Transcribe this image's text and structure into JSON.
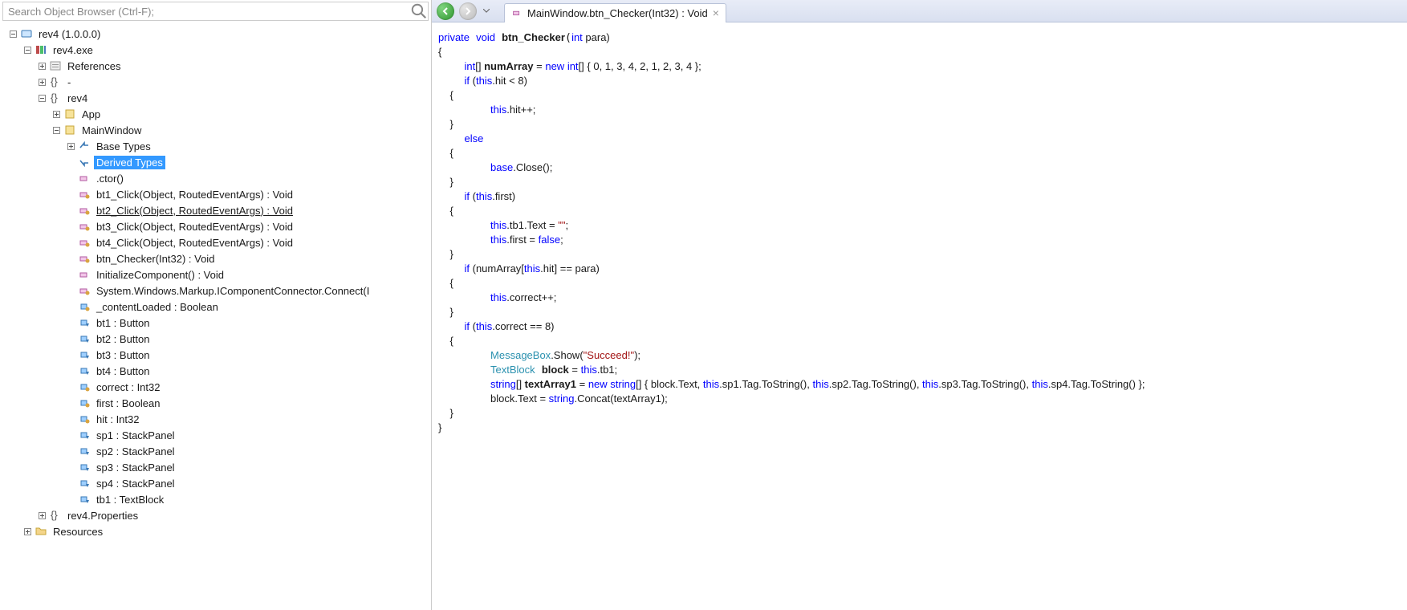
{
  "search": {
    "placeholder": "Search Object Browser (Ctrl-F);"
  },
  "tree": {
    "root": {
      "label": "rev4 (1.0.0.0)"
    },
    "exe": {
      "label": "rev4.exe"
    },
    "refs": {
      "label": "References"
    },
    "dash": {
      "label": "-"
    },
    "ns": {
      "label": "rev4"
    },
    "app": {
      "label": "App"
    },
    "main": {
      "label": "MainWindow"
    },
    "base": {
      "label": "Base Types"
    },
    "derived": {
      "label": "Derived Types"
    },
    "ctor": {
      "label": ".ctor()"
    },
    "bt1c": {
      "label": "bt1_Click(Object, RoutedEventArgs) : Void"
    },
    "bt2c": {
      "label": "bt2_Click(Object, RoutedEventArgs) : Void"
    },
    "bt3c": {
      "label": "bt3_Click(Object, RoutedEventArgs) : Void"
    },
    "bt4c": {
      "label": "bt4_Click(Object, RoutedEventArgs) : Void"
    },
    "btnchk": {
      "label": "btn_Checker(Int32) : Void"
    },
    "initcomp": {
      "label": "InitializeComponent() : Void"
    },
    "connect": {
      "label": "System.Windows.Markup.IComponentConnector.Connect(I"
    },
    "contentld": {
      "label": "_contentLoaded : Boolean"
    },
    "bt1": {
      "label": "bt1 : Button"
    },
    "bt2": {
      "label": "bt2 : Button"
    },
    "bt3": {
      "label": "bt3 : Button"
    },
    "bt4": {
      "label": "bt4 : Button"
    },
    "correct": {
      "label": "correct : Int32"
    },
    "first": {
      "label": "first : Boolean"
    },
    "hit": {
      "label": "hit : Int32"
    },
    "sp1": {
      "label": "sp1 : StackPanel"
    },
    "sp2": {
      "label": "sp2 : StackPanel"
    },
    "sp3": {
      "label": "sp3 : StackPanel"
    },
    "sp4": {
      "label": "sp4 : StackPanel"
    },
    "tb1": {
      "label": "tb1 : TextBlock"
    },
    "props": {
      "label": "rev4.Properties"
    },
    "res": {
      "label": "Resources"
    }
  },
  "tab": {
    "title": "MainWindow.btn_Checker(Int32) : Void"
  },
  "code": {
    "t_private": "private",
    "t_void": "void",
    "t_btnchk": "btn_Checker",
    "t_int": "int",
    "t_para": " para)",
    "l2": "{",
    "t_intarr": "int",
    "t_brk": "[] ",
    "t_numarr": "numArray",
    "t_eq": " = ",
    "t_new": "new",
    "t_intarr2": " int",
    "t_arrdata": "[] { 0, 1, 3, 4, 2, 1, 2, 3, 4 };",
    "t_if": "if",
    "t_hitcond": " (",
    "t_this": "this",
    "t_hit": ".hit < 8)",
    "l5": "    {",
    "t_hitpp": ".hit++;",
    "l7": "    }",
    "t_else": "else",
    "l9": "    {",
    "t_base": "base",
    "t_close": ".Close();",
    "l11": "    }",
    "t_firstcond": ".first)",
    "l13": "    {",
    "t_tb1text": ".tb1.Text = ",
    "t_emptystr": "\"\"",
    "t_semicolon": ";",
    "t_firstfalse": ".first = ",
    "t_false": "false",
    "l16": "    }",
    "t_numarrcond": " (numArray[",
    "t_hitidx": ".hit] == para)",
    "l18": "    {",
    "t_correctpp": ".correct++;",
    "l20": "    }",
    "t_correctcond": ".correct == 8)",
    "l22": "    {",
    "t_msgbox": "MessageBox",
    "t_show": ".Show(",
    "t_succeed": "\"Succeed!\"",
    "t_closeparen": ");",
    "t_textblock": "TextBlock",
    "t_block": "block",
    "t_eqtb1": " = ",
    "t_thistb1": ".tb1;",
    "t_string": "string",
    "t_textarr": "textArray1",
    "t_newstr": " = ",
    "t_newkw": "new",
    "t_strarr": " string",
    "t_arropen": "[] { block.Text, ",
    "t_sp1": ".sp1.Tag.ToString(), ",
    "t_sp2": ".sp2.Tag.ToString(), ",
    "t_sp3": ".sp3.Tag.ToString(), ",
    "t_sp4": ".sp4.Tag.ToString() };",
    "t_blocktext": "block.Text = ",
    "t_stringcls": "string",
    "t_concat": ".Concat(textArray1);",
    "l28": "    }",
    "l29": "}"
  }
}
